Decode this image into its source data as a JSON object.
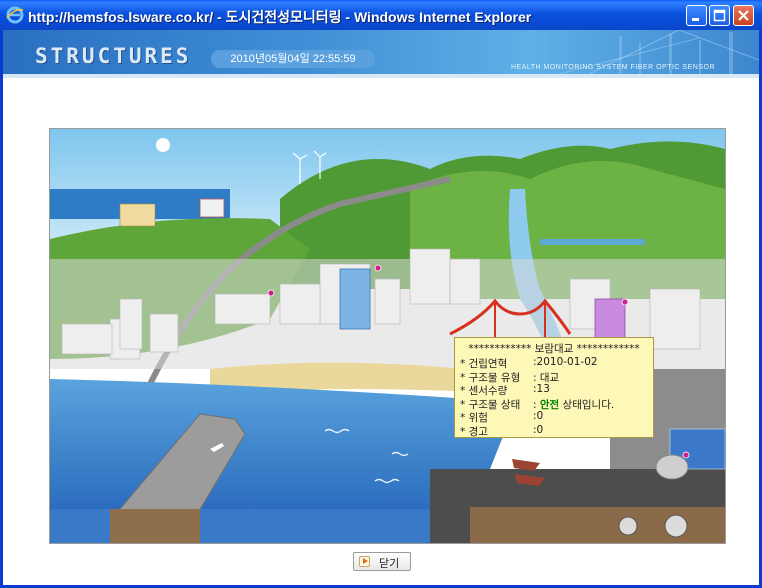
{
  "window": {
    "title": "http://hemsfos.lsware.co.kr/ - 도시건전성모니터링 - Windows Internet Explorer",
    "icon": "ie-icon",
    "controls": [
      "minimize-icon",
      "maximize-icon",
      "close-icon"
    ]
  },
  "header": {
    "brand": "STRUCTURES",
    "datetime": "2010년05월04일  22:55:59",
    "tagline": "HEALTH MONITORING SYSTEM FIBER OPTIC SENSOR"
  },
  "tooltip": {
    "title": "************ 보람대교 ************",
    "rows": [
      {
        "label": "* 건립연혁",
        "value": ":2010-01-02"
      },
      {
        "label": "* 구조물 유형",
        "value": ": 대교"
      },
      {
        "label": "* 센서수량",
        "value": ":13"
      },
      {
        "label": "* 구조물 상태",
        "value": ":"
      },
      {
        "label": "* 위험",
        "value": ":0"
      },
      {
        "label": "* 경고",
        "value": ":0"
      }
    ],
    "status_safe": "안전",
    "status_suffix": " 상태입니다."
  },
  "close_button": {
    "label": "닫기",
    "icon": "play-arrow-icon"
  },
  "colors": {
    "titlebar": "#0a52e0",
    "header": "#3f8fd6",
    "sea": "#2f78c8",
    "grass": "#5fa63a",
    "bridge": "#d8301e",
    "tooltip_bg": "#fdf7b8",
    "safe": "#008000"
  }
}
